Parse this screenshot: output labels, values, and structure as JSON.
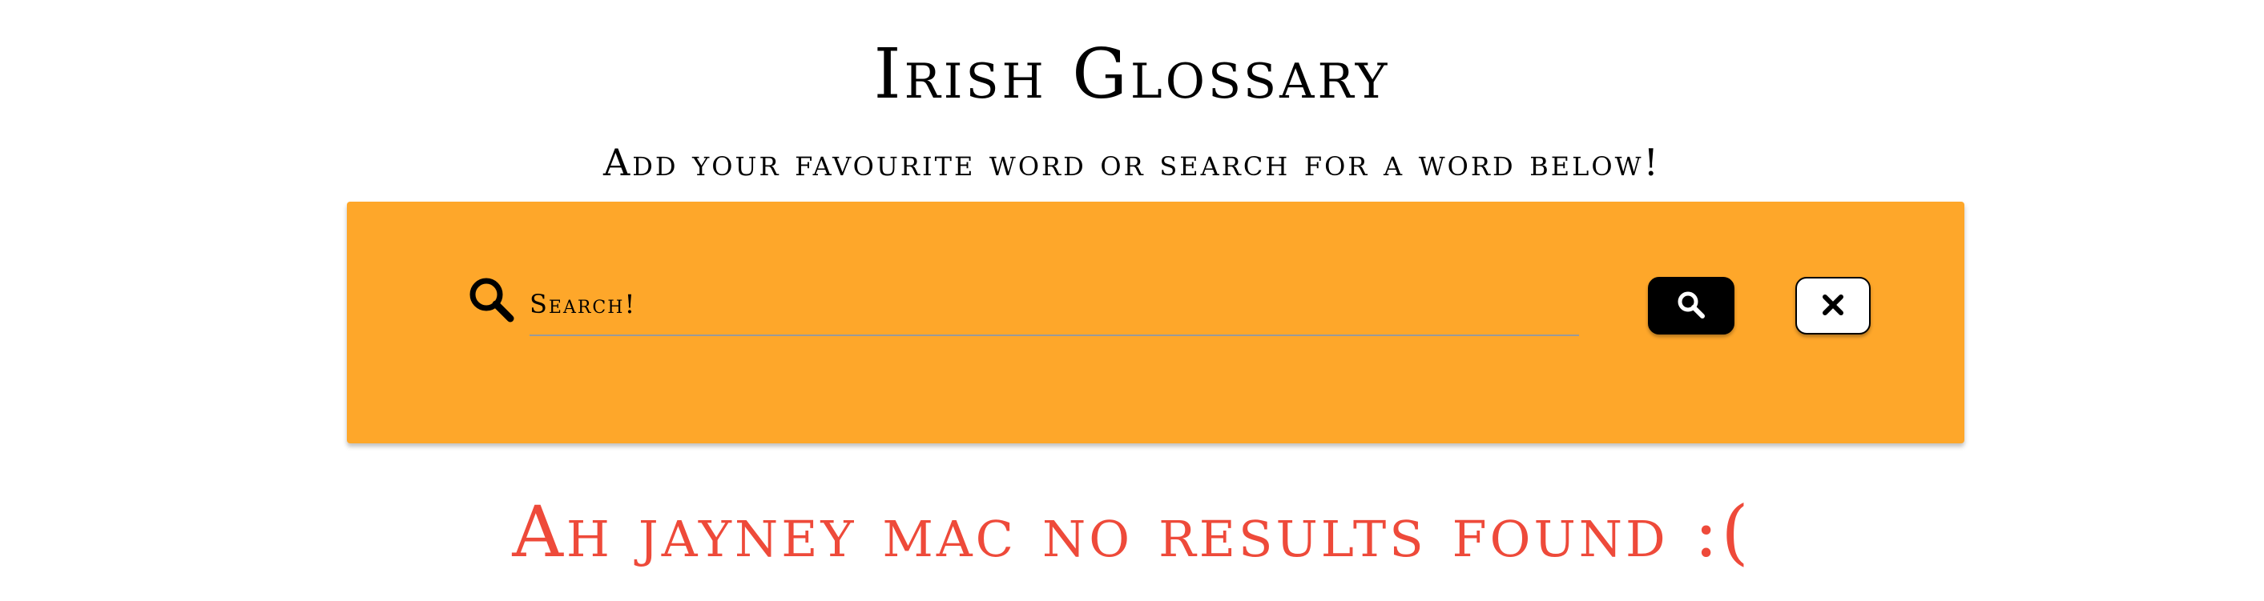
{
  "header": {
    "title": "Irish Glossary",
    "subtitle": "Add your favourite word or search for a word below!"
  },
  "search": {
    "placeholder": "Search!",
    "value": "",
    "icon": "search-icon",
    "search_button_icon": "search-icon",
    "clear_button_icon": "close-icon",
    "panel_color": "#fea72a"
  },
  "results": {
    "message": "Ah jayney mac no results found :(",
    "message_color": "#ee4a3a"
  }
}
